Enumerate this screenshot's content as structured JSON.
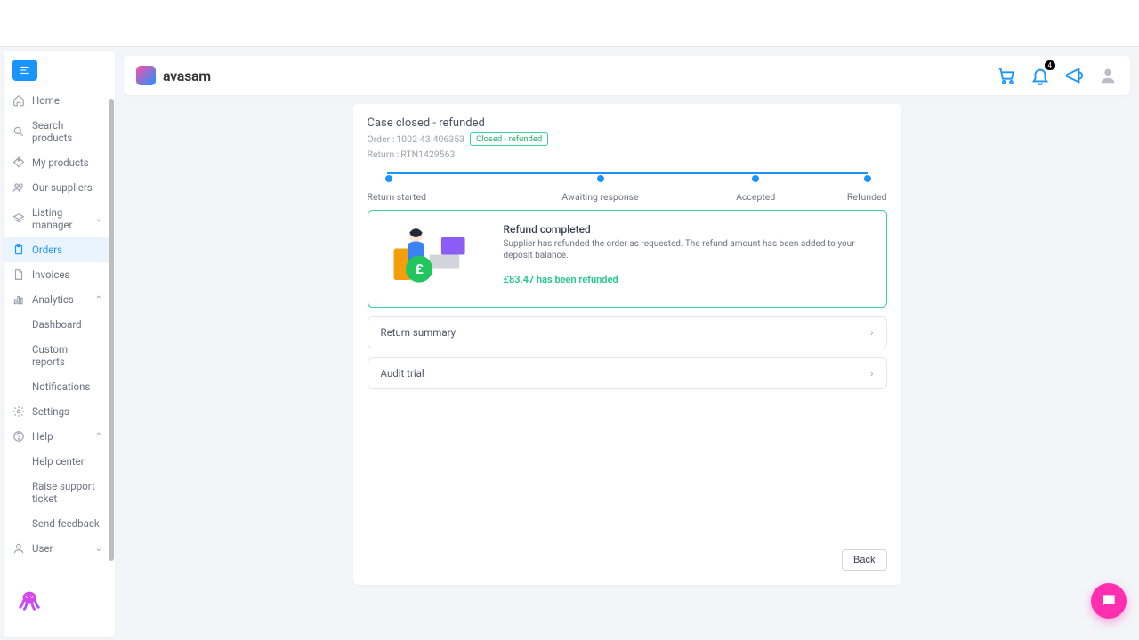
{
  "brand": {
    "name": "avasam"
  },
  "sidebar": {
    "items": [
      {
        "label": "Home",
        "icon": "home"
      },
      {
        "label": "Search products",
        "icon": "search"
      },
      {
        "label": "My products",
        "icon": "tag"
      },
      {
        "label": "Our suppliers",
        "icon": "people"
      },
      {
        "label": "Listing manager",
        "icon": "layers",
        "caret": "down"
      },
      {
        "label": "Orders",
        "icon": "clipboard",
        "active": true
      },
      {
        "label": "Invoices",
        "icon": "file"
      },
      {
        "label": "Analytics",
        "icon": "bars",
        "caret": "up"
      },
      {
        "label": "Dashboard",
        "sub": true
      },
      {
        "label": "Custom reports",
        "sub": true
      },
      {
        "label": "Notifications",
        "sub": true
      },
      {
        "label": "Settings",
        "icon": "gear"
      },
      {
        "label": "Help",
        "icon": "help",
        "caret": "up"
      },
      {
        "label": "Help center",
        "sub": true
      },
      {
        "label": "Raise support ticket",
        "sub": true
      },
      {
        "label": "Send feedback",
        "sub": true
      },
      {
        "label": "User",
        "icon": "user",
        "caret": "down"
      }
    ]
  },
  "header": {
    "notification_count": "4"
  },
  "case": {
    "title": "Case closed - refunded",
    "order_prefix": "Order : ",
    "order_number": "1002-43-406353",
    "status": "Closed - refunded",
    "return_prefix": "Return : ",
    "return_number": "RTN1429563"
  },
  "stepper": [
    {
      "label": "Return started"
    },
    {
      "label": "Awaiting response"
    },
    {
      "label": "Accepted"
    },
    {
      "label": "Refunded"
    }
  ],
  "refund": {
    "title": "Refund completed",
    "description": "Supplier has refunded the order as requested. The refund amount has been added to your deposit balance.",
    "amount_text": "£83.47 has been refunded"
  },
  "accordions": [
    {
      "label": "Return summary"
    },
    {
      "label": "Audit trial"
    }
  ],
  "buttons": {
    "back": "Back"
  }
}
